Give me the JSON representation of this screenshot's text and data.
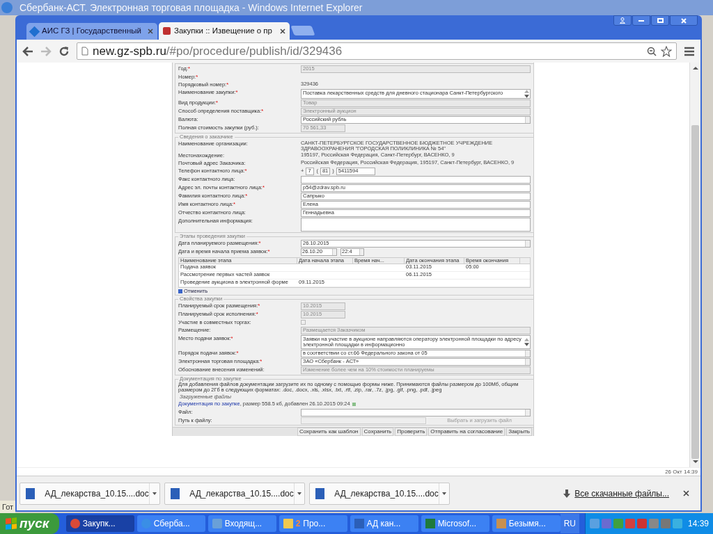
{
  "background_window": {
    "title": "Сбербанк-АСТ. Электронная торговая площадка - Windows Internet Explorer",
    "status_fragment": "Гот"
  },
  "browser": {
    "tabs": [
      {
        "label": "АИС ГЗ | Государственный",
        "selected": false
      },
      {
        "label": "Закупки :: Извещение о пр",
        "selected": true
      }
    ],
    "url_host": "new.gz-spb.ru",
    "url_path": "/#po/procedure/publish/id/329436"
  },
  "form": {
    "required_mark": "*",
    "sections": [
      {
        "fields": [
          {
            "label": "Год:",
            "required": true,
            "kind": "disabled",
            "value": "2015"
          },
          {
            "label": "Номер:",
            "required": true,
            "kind": "empty"
          },
          {
            "label": "Порядковый номер:",
            "required": true,
            "kind": "plain",
            "value": "329436"
          },
          {
            "label": "Наименование закупки:",
            "required": true,
            "kind": "textarea",
            "value": "Поставка лекарственных средств для дневного стационара Санкт-Петербургского"
          },
          {
            "label": "Вид продукции:",
            "required": true,
            "kind": "disabled",
            "value": "Товар"
          },
          {
            "label": "Способ определения поставщика:",
            "required": true,
            "kind": "disabled",
            "value": "Электронный аукцион"
          },
          {
            "label": "Валюта:",
            "required": false,
            "kind": "select",
            "value": "Российский рубль"
          },
          {
            "label": "Полная стоимость закупки (руб.):",
            "required": false,
            "kind": "short",
            "value": "70 561,33"
          }
        ]
      },
      {
        "title": "Сведения о заказчике",
        "fields": [
          {
            "label": "Наименование организации:",
            "required": false,
            "kind": "plain",
            "value": "САНКТ-ПЕТЕРБУРГСКОЕ ГОСУДАРСТВЕННОЕ БЮДЖЕТНОЕ УЧРЕЖДЕНИЕ ЗДРАВООХРАНЕНИЯ \"ГОРОДСКАЯ ПОЛИКЛИНИКА № 54\""
          },
          {
            "label": "Местонахождение:",
            "required": false,
            "kind": "plain",
            "value": "195197, Российская Федерация, Санкт-Петербург, ВАСЕНКО, 9"
          },
          {
            "label": "Почтовый адрес Заказчика:",
            "required": false,
            "kind": "plain",
            "value": "Российская Федерация, Российская Федерация, 195197, Санкт-Петербург, ВАСЕНКО, 9"
          },
          {
            "label": "Телефон контактного лица:",
            "required": true,
            "kind": "phone",
            "parts": [
              {
                "text": "+",
                "kind": "sep"
              },
              {
                "text": "7",
                "kind": "box"
              },
              {
                "text": "(",
                "kind": "sep"
              },
              {
                "text": "81",
                "kind": "box"
              },
              {
                "text": ")",
                "kind": "sep"
              },
              {
                "text": "5411594",
                "kind": "box"
              }
            ]
          },
          {
            "label": "Факс контактного лица:",
            "required": false,
            "kind": "input"
          },
          {
            "label": "Адрес эл. почты контактного лица:",
            "required": true,
            "kind": "input",
            "value": "p54@zdrav.spb.ru"
          },
          {
            "label": "Фамилия контактного лица:",
            "required": true,
            "kind": "input",
            "value": "Сапрыко"
          },
          {
            "label": "Имя контактного лица:",
            "required": true,
            "kind": "input",
            "value": "Елена"
          },
          {
            "label": "Отчество контактного лица:",
            "required": false,
            "kind": "input",
            "value": "Геннадьевна"
          },
          {
            "label": "Дополнительная информация:",
            "required": false,
            "kind": "bigtext"
          }
        ]
      },
      {
        "title": "Этапы проведения закупки",
        "fields": [
          {
            "label": "Дата планируемого размещения:",
            "required": true,
            "kind": "select",
            "value": "26.10.2015"
          },
          {
            "label": "Дата и время начала приема заявок:",
            "required": true,
            "kind": "datetime",
            "parts": [
              "26.10.20",
              "22:4"
            ]
          }
        ],
        "stages": {
          "columns": [
            "Наименование этапа",
            "Дата начала этапа",
            "Время нач...",
            "Дата окончания этапа",
            "Время окончания"
          ],
          "rows": [
            [
              "Подача заявок",
              "",
              "",
              "03.11.2015",
              "05:00"
            ],
            [
              "Рассмотрение первых частей заявок",
              "",
              "",
              "06.11.2015",
              ""
            ],
            [
              "Проведение аукциона в электронной форме",
              "09.11.2015",
              "",
              "",
              ""
            ]
          ]
        },
        "cancel_link": "Отменить"
      },
      {
        "title": "Свойства закупки",
        "fields": [
          {
            "label": "Планируемый срок размещения:",
            "required": true,
            "kind": "short",
            "value": "10.2015"
          },
          {
            "label": "Планируемый срок исполнения:",
            "required": true,
            "kind": "short",
            "value": "10.2015"
          },
          {
            "label": "Участие в совместных торгах:",
            "required": false,
            "kind": "checkbox",
            "checked": false
          },
          {
            "label": "Размещение:",
            "required": false,
            "kind": "disabled",
            "value": "Размещается Заказчиком"
          },
          {
            "label": "Место подачи заявок:",
            "required": true,
            "kind": "textarea",
            "value": "Заявки на участие в аукционе направляются оператору электронной площадки по адресу электронной площадки в информационно"
          },
          {
            "label": "Порядок подачи заявок:",
            "required": true,
            "kind": "select",
            "value": "в соответствии со ст.66 Федерального закона от 05"
          },
          {
            "label": "Электронная торговая площадка:",
            "required": true,
            "kind": "select",
            "value": "ЗАО «Сбербанк - АСТ»"
          },
          {
            "label": "Обоснование внесения изменений:",
            "required": false,
            "kind": "disabled",
            "value": "Изменение более чем на 10% стоимости планируемы"
          }
        ]
      },
      {
        "title": "Документация по закупке",
        "docs": {
          "note": "Для добавления файлов документации загрузите их по одному с помощью формы ниже. Принимаются файлы размером до 100Мб, общим размером до 2Гб в следующих форматах: .doc, .docx, .xls, .xlsx, .txt, .rtf, .zip, .rar, .7z, .jpg, .gif, .png, .pdf, .jpeg",
          "uploaded_title": "Загруженные файлы",
          "file_link": "Документация по закупке",
          "file_info": ", размер 558.5 кб, добавлен 26.10.2015 09:24"
        },
        "after_fields": [
          {
            "label": "Файл:",
            "required": false,
            "kind": "select"
          },
          {
            "label": "Путь к файлу:",
            "required": false,
            "kind": "file",
            "button": "Выбрать и загрузить файл"
          }
        ]
      }
    ],
    "buttons": [
      "Сохранить как шаблон",
      "Сохранить",
      "Проверить",
      "Отправить на согласование",
      "Закрыть"
    ]
  },
  "page_footer": "26 Окт 14:39",
  "downloads": {
    "items": [
      "АД_лекарства_10.15....doc",
      "АД_лекарства_10.15....doc",
      "АД_лекарства_10.15....doc"
    ],
    "all_link": "Все скачанные файлы..."
  },
  "taskbar": {
    "start": "пуск",
    "items": [
      {
        "label": "Закупк...",
        "selected": true
      },
      {
        "label": "Сберба...",
        "selected": false
      },
      {
        "label": "Входящ...",
        "selected": false
      },
      {
        "label": "Про...",
        "count": "2",
        "selected": false
      },
      {
        "label": "АД кан...",
        "selected": false
      },
      {
        "label": "Microsof...",
        "selected": false
      },
      {
        "label": "Безымя...",
        "selected": false
      }
    ],
    "language": "RU",
    "clock": "14:39"
  }
}
